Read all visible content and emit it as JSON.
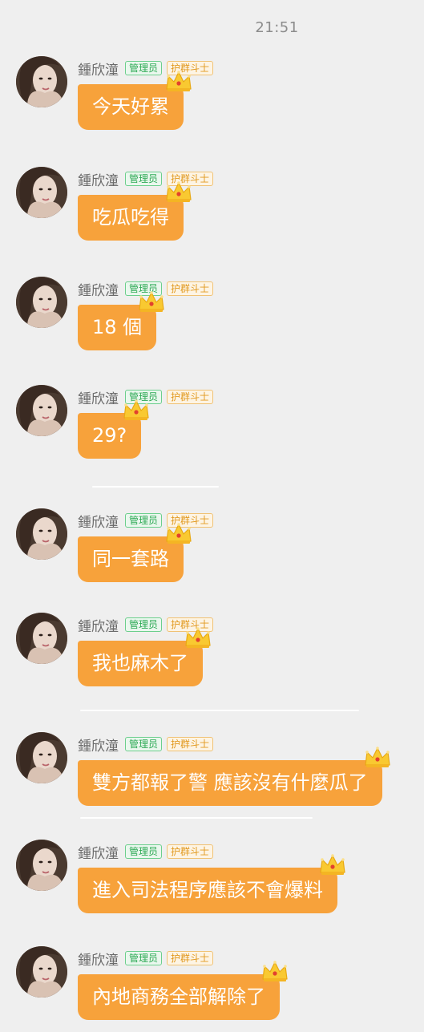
{
  "chat": {
    "timestamp": "21:51",
    "messages": [
      {
        "sender": "鍾欣潼",
        "badge_admin": "管理员",
        "badge_guard": "护群斗士",
        "text": "今天好累"
      },
      {
        "sender": "鍾欣潼",
        "badge_admin": "管理员",
        "badge_guard": "护群斗士",
        "text": "吃瓜吃得"
      },
      {
        "sender": "鍾欣潼",
        "badge_admin": "管理员",
        "badge_guard": "护群斗士",
        "text": "18 個"
      },
      {
        "sender": "鍾欣潼",
        "badge_admin": "管理员",
        "badge_guard": "护群斗士",
        "text": "29?"
      },
      {
        "sender": "鍾欣潼",
        "badge_admin": "管理员",
        "badge_guard": "护群斗士",
        "text": "同一套路"
      },
      {
        "sender": "鍾欣潼",
        "badge_admin": "管理员",
        "badge_guard": "护群斗士",
        "text": "我也麻木了"
      },
      {
        "sender": "鍾欣潼",
        "badge_admin": "管理员",
        "badge_guard": "护群斗士",
        "text": "雙方都報了警 應該沒有什麼瓜了"
      },
      {
        "sender": "鍾欣潼",
        "badge_admin": "管理员",
        "badge_guard": "护群斗士",
        "text": "進入司法程序應該不會爆料"
      },
      {
        "sender": "鍾欣潼",
        "badge_admin": "管理员",
        "badge_guard": "护群斗士",
        "text": "內地商務全部解除了"
      }
    ]
  },
  "colors": {
    "bubble": "#f7a23b",
    "admin_badge": "#2eaa55",
    "guard_badge": "#e29a21",
    "background": "#efefef"
  },
  "icons": {
    "crown": "crown-icon",
    "avatar": "avatar"
  }
}
